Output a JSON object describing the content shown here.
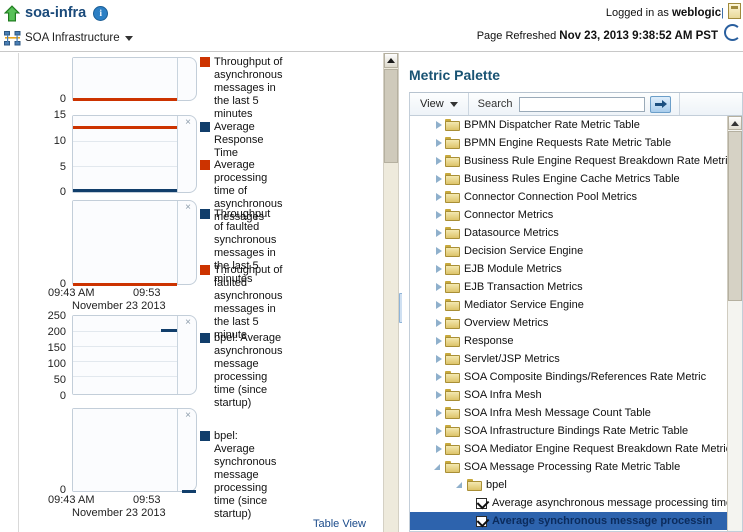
{
  "header": {
    "app_title": "soa-infra",
    "info_icon": "info-icon",
    "up_arrow_icon": "green-up-arrow-icon",
    "breadcrumb_label": "SOA Infrastructure",
    "mesh_icon": "soa-mesh-icon",
    "logged_in_prefix": "Logged in as ",
    "logged_in_user": "weblogic",
    "user_icon": "user-card-icon",
    "page_refreshed_prefix": "Page Refreshed ",
    "page_refreshed_time": "Nov 23, 2013 9:38:52 AM PST",
    "refresh_icon": "refresh-circle-icon"
  },
  "left_panel": {
    "table_view_link": "Table View",
    "close_label": "×",
    "charts": [
      {
        "name": "throughput-async-chart",
        "y_ticks": [
          "0"
        ],
        "x_ticks": [],
        "x_axis_title": "",
        "series": [
          {
            "color": "#cc3300",
            "value": 0
          }
        ],
        "legend": [
          {
            "color": "#cc3300",
            "label": "Throughput of asynchronous messages in the last 5 minutes"
          }
        ]
      },
      {
        "name": "average-response-time-chart",
        "y_ticks": [
          "15",
          "10",
          "5",
          "0"
        ],
        "x_ticks": [],
        "x_axis_title": "",
        "series": [
          {
            "color": "#cc3300",
            "value": 13
          },
          {
            "color": "#113e6b",
            "value": 0
          }
        ],
        "legend": [
          {
            "color": "#113e6b",
            "label": "Average Response Time"
          },
          {
            "color": "#cc3300",
            "label": "Average processing time of asynchronous messages"
          }
        ]
      },
      {
        "name": "throughput-faulted-chart",
        "y_ticks": [
          "0"
        ],
        "x_ticks": [
          "09:43 AM",
          "09:53"
        ],
        "x_axis_title": "November 23 2013",
        "series": [
          {
            "color": "#cc3300",
            "value": 0
          }
        ],
        "legend": [
          {
            "color": "#113e6b",
            "label": "Throughput of faulted synchronous messages in the last 5 minutes"
          },
          {
            "color": "#cc3300",
            "label": "Throughput of faulted asynchronous messages in the last 5 minute"
          }
        ]
      },
      {
        "name": "bpel-average-async-chart",
        "y_ticks": [
          "250",
          "200",
          "150",
          "100",
          "50",
          "0"
        ],
        "x_ticks": [],
        "x_axis_title": "",
        "series": [
          {
            "color": "#113e6b",
            "value": 205
          }
        ],
        "legend": [
          {
            "color": "#113e6b",
            "label": "bpel: Average asynchronous message processing time (since startup)"
          }
        ]
      },
      {
        "name": "bpel-average-sync-chart",
        "y_ticks": [
          "0"
        ],
        "x_ticks": [
          "09:43 AM",
          "09:53"
        ],
        "x_axis_title": "November 23 2013",
        "series": [
          {
            "color": "#113e6b",
            "value": 0
          }
        ],
        "legend": [
          {
            "color": "#113e6b",
            "label": "bpel: Average synchronous message processing time (since startup)"
          }
        ]
      }
    ]
  },
  "palette": {
    "title": "Metric Palette",
    "toolbar": {
      "view_label": "View",
      "view_caret_icon": "chevron-down-icon",
      "search_label": "Search",
      "search_value": "",
      "search_placeholder": "",
      "go_icon": "arrow-right-icon"
    },
    "tree": [
      {
        "label": "BPMN Dispatcher Rate Metric Table",
        "type": "folder",
        "indent": 1,
        "expanded": false
      },
      {
        "label": "BPMN Engine Requests Rate Metric Table",
        "type": "folder",
        "indent": 1,
        "expanded": false
      },
      {
        "label": "Business Rule Engine Request Breakdown Rate Metric T",
        "type": "folder",
        "indent": 1,
        "expanded": false
      },
      {
        "label": "Business Rules Engine Cache Metrics Table",
        "type": "folder",
        "indent": 1,
        "expanded": false
      },
      {
        "label": "Connector Connection Pool Metrics",
        "type": "folder",
        "indent": 1,
        "expanded": false
      },
      {
        "label": "Connector Metrics",
        "type": "folder",
        "indent": 1,
        "expanded": false
      },
      {
        "label": "Datasource Metrics",
        "type": "folder",
        "indent": 1,
        "expanded": false
      },
      {
        "label": "Decision Service Engine",
        "type": "folder",
        "indent": 1,
        "expanded": false
      },
      {
        "label": "EJB Module Metrics",
        "type": "folder",
        "indent": 1,
        "expanded": false
      },
      {
        "label": "EJB Transaction Metrics",
        "type": "folder",
        "indent": 1,
        "expanded": false
      },
      {
        "label": "Mediator Service Engine",
        "type": "folder",
        "indent": 1,
        "expanded": false
      },
      {
        "label": "Overview Metrics",
        "type": "folder",
        "indent": 1,
        "expanded": false
      },
      {
        "label": "Response",
        "type": "folder",
        "indent": 1,
        "expanded": false
      },
      {
        "label": "Servlet/JSP Metrics",
        "type": "folder",
        "indent": 1,
        "expanded": false
      },
      {
        "label": "SOA Composite Bindings/References Rate Metric",
        "type": "folder",
        "indent": 1,
        "expanded": false
      },
      {
        "label": "SOA Infra Mesh",
        "type": "folder",
        "indent": 1,
        "expanded": false
      },
      {
        "label": "SOA Infra Mesh Message Count Table",
        "type": "folder",
        "indent": 1,
        "expanded": false
      },
      {
        "label": "SOA Infrastructure Bindings Rate Metric Table",
        "type": "folder",
        "indent": 1,
        "expanded": false
      },
      {
        "label": "SOA Mediator Engine Request Breakdown Rate Metric T",
        "type": "folder",
        "indent": 1,
        "expanded": false
      },
      {
        "label": "SOA Message Processing Rate Metric Table",
        "type": "folder",
        "indent": 1,
        "expanded": true
      },
      {
        "label": "bpel",
        "type": "folder",
        "indent": 2,
        "expanded": true
      },
      {
        "label": "Average asynchronous message processing time",
        "type": "checkbox",
        "indent": 3,
        "checked": true,
        "selected": false
      },
      {
        "label": "Average synchronous message processin",
        "type": "checkbox",
        "indent": 3,
        "checked": true,
        "selected": true
      }
    ]
  }
}
